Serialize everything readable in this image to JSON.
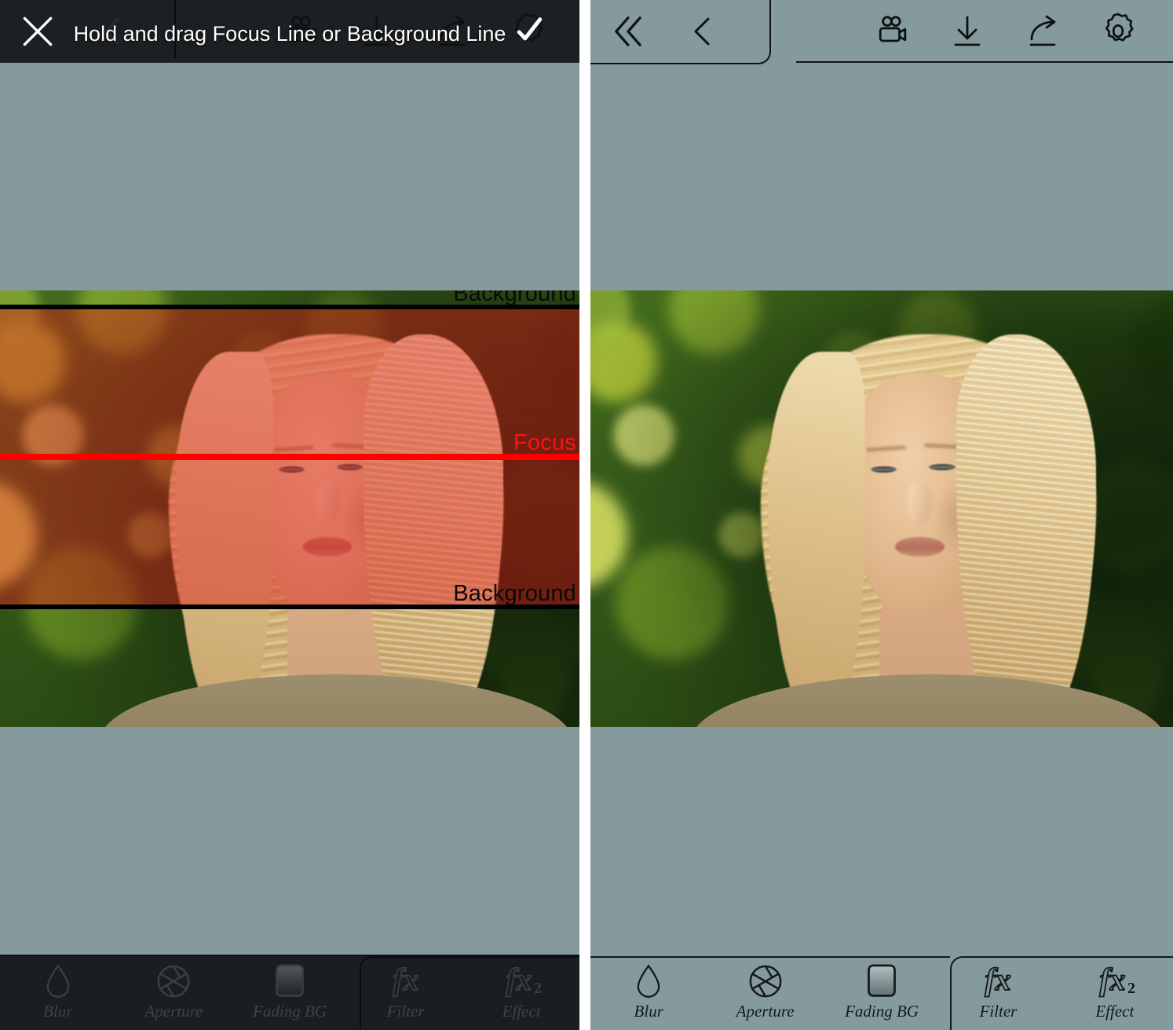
{
  "app": {
    "background_color": "#849a9d",
    "toolbar_dark_color": "#1d2022",
    "focus_line_color": "#ff0000",
    "background_line_color": "#000000",
    "focus_tint_color": "#dc1818"
  },
  "left_panel": {
    "topbar": {
      "close_label": "close-icon",
      "back_label": "back-icon",
      "video_label": "video-camera-icon",
      "download_label": "download-icon",
      "share_label": "share-icon",
      "apply_label": "gear-check-icon"
    },
    "overlay": {
      "background_top_label": "Background",
      "focus_label": "Focus",
      "background_bottom_label": "Background"
    },
    "toast": {
      "message": "Hold and drag Focus Line or Background Line"
    },
    "bottombar": {
      "items": [
        {
          "label": "Blur",
          "icon": "droplet-icon"
        },
        {
          "label": "Aperture",
          "icon": "aperture-icon"
        },
        {
          "label": "Fading BG",
          "icon": "fading-bg-icon"
        },
        {
          "label": "Filter",
          "icon": "fx-icon"
        },
        {
          "label": "Effect",
          "icon": "fx2-icon"
        }
      ]
    }
  },
  "right_panel": {
    "topbar": {
      "collapse_label": "double-chevron-left-icon",
      "back_label": "back-icon",
      "video_label": "video-camera-icon",
      "download_label": "download-icon",
      "share_label": "share-icon",
      "settings_label": "gear-icon"
    },
    "bottombar": {
      "items": [
        {
          "label": "Blur",
          "icon": "droplet-icon"
        },
        {
          "label": "Aperture",
          "icon": "aperture-icon"
        },
        {
          "label": "Fading BG",
          "icon": "fading-bg-icon"
        },
        {
          "label": "Filter",
          "icon": "fx-icon"
        },
        {
          "label": "Effect",
          "icon": "fx2-icon"
        }
      ]
    }
  }
}
